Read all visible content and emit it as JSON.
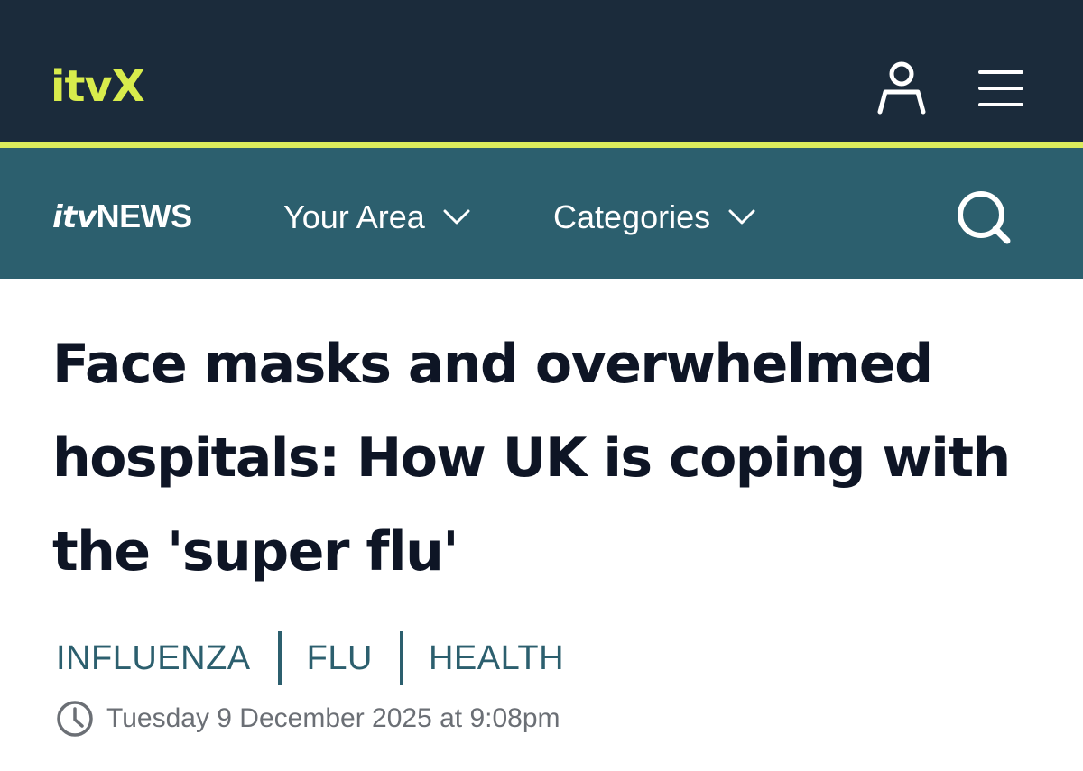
{
  "header": {
    "logo_text": "itv",
    "logo_x": "X",
    "icons": [
      "account-icon",
      "menu-icon"
    ],
    "bg_color": "#1b2b3b",
    "accent_color": "#dcec5c"
  },
  "news_nav": {
    "logo_itv": "itv",
    "logo_news": "NEWS",
    "your_area_label": "Your Area",
    "categories_label": "Categories",
    "icons": [
      "chevron-down-icon",
      "search-icon"
    ],
    "bg_color": "#2c5f6e"
  },
  "article": {
    "headline": "Face masks and overwhelmed hospitals: How UK is coping with the 'super flu'",
    "tags": [
      "INFLUENZA",
      "FLU",
      "HEALTH"
    ],
    "date": "Tuesday 9 December 2025 at 9:08pm",
    "tag_color": "#2c5f6e"
  }
}
